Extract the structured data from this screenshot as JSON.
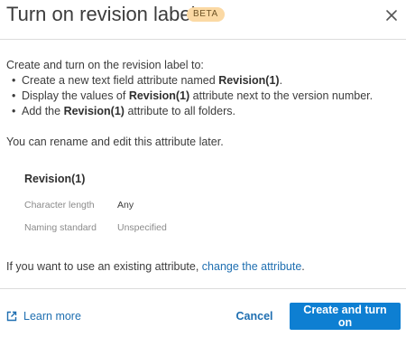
{
  "dialog": {
    "title": "Turn on revision label",
    "badge": "BETA"
  },
  "intro": "Create and turn on the revision label to:",
  "bullets": [
    {
      "before": "Create a new text field attribute named ",
      "bold": "Revision(1)",
      "after": "."
    },
    {
      "before": "Display the values of ",
      "bold": "Revision(1)",
      "after": " attribute next to the version number."
    },
    {
      "before": "Add the ",
      "bold": "Revision(1)",
      "after": " attribute to all folders."
    }
  ],
  "rename_note": "You can rename and edit this attribute later.",
  "attribute": {
    "name": "Revision(1)",
    "properties": [
      {
        "label": "Character length",
        "value": "Any"
      },
      {
        "label": "Naming standard",
        "value": "Unspecified"
      }
    ]
  },
  "existing": {
    "prefix": "If you want to use an existing attribute, ",
    "link": "change the attribute",
    "suffix": "."
  },
  "footer": {
    "learn_more": "Learn more",
    "cancel": "Cancel",
    "primary": "Create and turn on"
  },
  "icons": {
    "close": "close-icon",
    "external_link": "external-link-icon"
  },
  "colors": {
    "link": "#1f6fb1",
    "primary_button": "#0e7fd2",
    "badge_bg": "#fbd9a4",
    "divider": "#dcdcdc"
  }
}
